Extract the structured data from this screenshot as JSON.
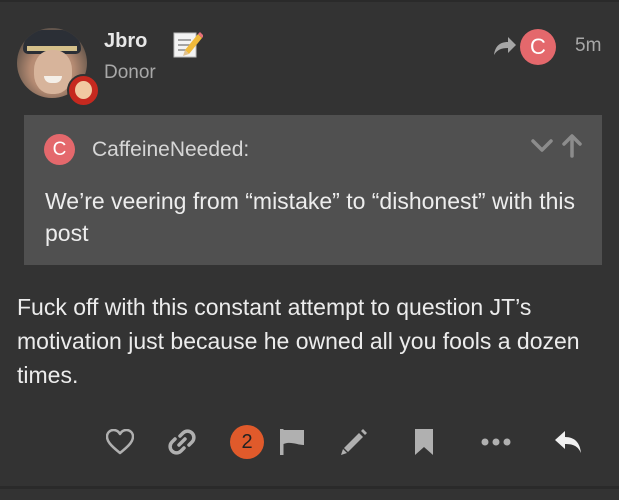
{
  "post": {
    "username": "Jbro",
    "user_title": "Donor",
    "post_date": "5m",
    "reply_to_avatar_letter": "C",
    "body": "Fuck off with this constant attempt to question JT’s motivation just because he owned all you fools a dozen times."
  },
  "quote": {
    "avatar_letter": "C",
    "username": "CaffeineNeeded:",
    "text": "We’re veering from “mistake” to “dishonest” with this post"
  },
  "actions": {
    "like_count": "2",
    "icons": [
      "heart-icon",
      "link-icon",
      "flag-icon",
      "edit-icon",
      "bookmark-icon",
      "more-icon",
      "reply-icon"
    ]
  },
  "colors": {
    "background": "#333333",
    "quote_background": "#505050",
    "avatar_letter_bg": "#e4686c",
    "like_badge": "#e05a2b"
  }
}
